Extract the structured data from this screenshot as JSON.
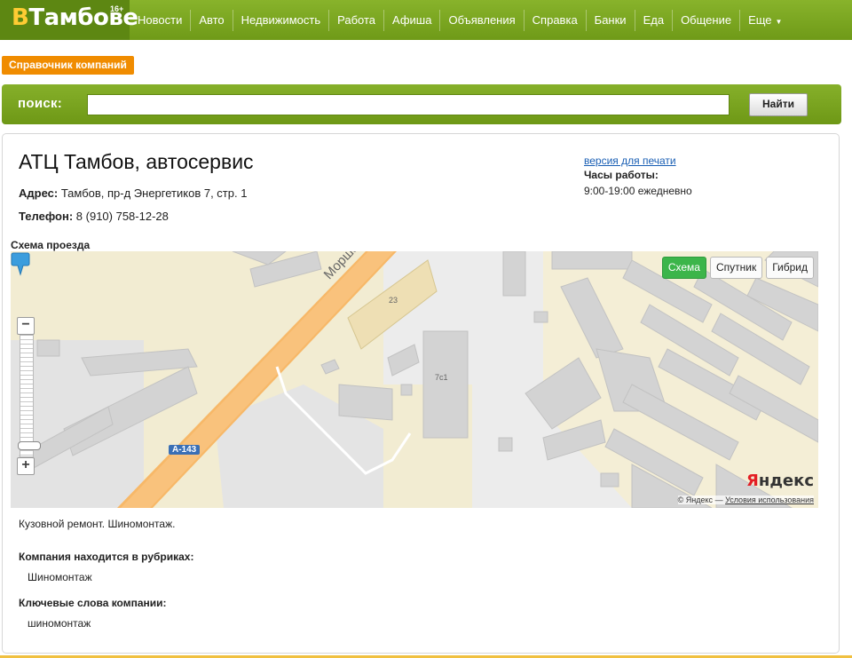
{
  "logo": {
    "v": "В",
    "name": "Тамбове",
    "age": "16+"
  },
  "nav": [
    "Новости",
    "Авто",
    "Недвижимость",
    "Работа",
    "Афиша",
    "Объявления",
    "Справка",
    "Банки",
    "Еда",
    "Общение",
    "Еще"
  ],
  "directory_tag": "Справочник компаний",
  "search": {
    "label": "поиск:",
    "value": "",
    "placeholder": "",
    "button": "Найти"
  },
  "company": {
    "title": "АТЦ Тамбов, автосервис",
    "address_label": "Адрес:",
    "address": "Тамбов, пр-д Энергетиков 7, стр. 1",
    "phone_label": "Телефон:",
    "phone": "8 (910) 758-12-28",
    "print_link": "версия для печати",
    "hours_label": "Часы работы:",
    "hours": "9:00-19:00 ежедневно",
    "description": "Кузовной ремонт. Шиномонтаж.",
    "rubrics_label": "Компания находится в рубриках:",
    "rubric": "Шиномонтаж",
    "keywords_label": "Ключевые слова компании:",
    "keywords": "шиномонтаж"
  },
  "map": {
    "section_title": "Схема проезда",
    "tabs": [
      "Схема",
      "Спутник",
      "Гибрид"
    ],
    "active_tab": "Схема",
    "zoom_in": "+",
    "zoom_out": "−",
    "zoom_level": 0.93,
    "street": "Морша",
    "road_badge": "А-143",
    "house_23": "23",
    "house_7": "7с1",
    "yandex_logo": {
      "y": "Я",
      "rest": "ндекс"
    },
    "copyright": "© Яндекс",
    "copyright_sep": "—",
    "terms": "Условия использования"
  },
  "colors": {
    "nav_green": "#7aa51f",
    "tag_orange": "#f08c00",
    "active_tab_green": "#3cb54a",
    "road_orange": "#f7b868",
    "pin_blue": "#3b9ddd"
  }
}
